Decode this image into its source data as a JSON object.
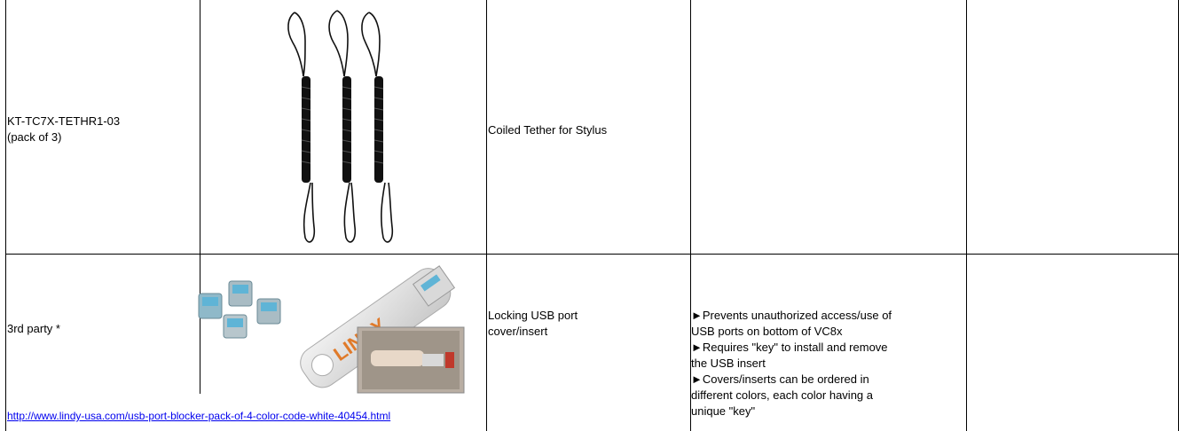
{
  "rows": [
    {
      "part_number_line1": "KT-TC7X-TETHR1-03",
      "part_number_line2": "(pack of 3)",
      "image_icon": "coiled-tether-image",
      "description": "Coiled Tether for Stylus",
      "notes": [],
      "extra": ""
    },
    {
      "part_number_line1": "3rd party *",
      "image_icon": "usb-port-blocker-image",
      "image_logo_text": "LINDY",
      "description_line1": "Locking USB port",
      "description_line2": "cover/insert",
      "notes": [
        "►Prevents unauthorized access/use of",
        "USB ports on bottom of VC8x",
        "►Requires \"key\" to install and remove",
        "the USB insert",
        "►Covers/inserts can be ordered in",
        "different colors, each color having a",
        "unique \"key\""
      ],
      "link_text": "http://www.lindy-usa.com/usb-port-blocker-pack-of-4-color-code-white-40454.html",
      "extra": ""
    }
  ]
}
